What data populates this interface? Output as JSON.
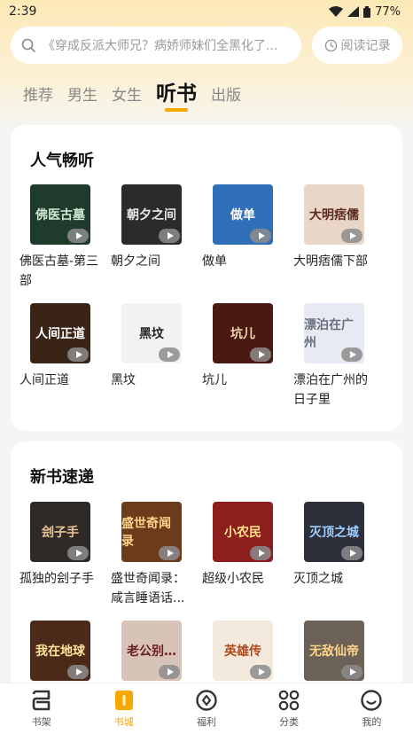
{
  "status": {
    "time": "2:39",
    "battery": "77%"
  },
  "search": {
    "placeholder": "《穿成反派大师兄？病娇师妹们全黑化了...",
    "history_label": "阅读记录"
  },
  "tabs": [
    {
      "label": "推荐",
      "active": false
    },
    {
      "label": "男生",
      "active": false
    },
    {
      "label": "女生",
      "active": false
    },
    {
      "label": "听书",
      "active": true
    },
    {
      "label": "出版",
      "active": false
    }
  ],
  "sections": [
    {
      "title": "人气畅听",
      "books": [
        {
          "title": "佛医古墓-第三部",
          "cover_text": "佛医古墓",
          "cover_bg": "#1f3b2c",
          "cover_fg": "#cfe8d4"
        },
        {
          "title": "朝夕之间",
          "cover_text": "朝夕之间",
          "cover_bg": "#2b2b2b",
          "cover_fg": "#e8e8e8"
        },
        {
          "title": "做单",
          "cover_text": "做单",
          "cover_bg": "#2e6fb7",
          "cover_fg": "#ffffff"
        },
        {
          "title": "大明痞儒下部",
          "cover_text": "大明痞儒",
          "cover_bg": "#e9d6c7",
          "cover_fg": "#5a2b1e"
        },
        {
          "title": "人间正道",
          "cover_text": "人间正道",
          "cover_bg": "#3a2416",
          "cover_fg": "#ffffff"
        },
        {
          "title": "黑坟",
          "cover_text": "黑坟",
          "cover_bg": "#f2f2f2",
          "cover_fg": "#222222"
        },
        {
          "title": "坑儿",
          "cover_text": "坑儿",
          "cover_bg": "#4a1a12",
          "cover_fg": "#f1d7b0"
        },
        {
          "title": "漂泊在广州的日子里",
          "cover_text": "漂泊在广州",
          "cover_bg": "#e7eaf2",
          "cover_fg": "#6a6f80"
        }
      ]
    },
    {
      "title": "新书速递",
      "books": [
        {
          "title": "孤独的刽子手",
          "cover_text": "刽子手",
          "cover_bg": "#2f2a25",
          "cover_fg": "#e7c39a"
        },
        {
          "title": "盛世奇闻录：咸言睡语话...",
          "cover_text": "盛世奇闻录",
          "cover_bg": "#6b3b1c",
          "cover_fg": "#ffd48a"
        },
        {
          "title": "超级小农民",
          "cover_text": "小农民",
          "cover_bg": "#8d1e1e",
          "cover_fg": "#ffe08a"
        },
        {
          "title": "灭顶之城",
          "cover_text": "灭顶之城",
          "cover_bg": "#2d2f3a",
          "cover_fg": "#9ed0ff"
        },
        {
          "title": "",
          "cover_text": "我在地球",
          "cover_bg": "#4b2a1a",
          "cover_fg": "#ffe49a"
        },
        {
          "title": "",
          "cover_text": "老公别…",
          "cover_bg": "#d8c3b8",
          "cover_fg": "#6b1f1f"
        },
        {
          "title": "",
          "cover_text": "英雄传",
          "cover_bg": "#f3e9dc",
          "cover_fg": "#b14a1b"
        },
        {
          "title": "",
          "cover_text": "无敌仙帝",
          "cover_bg": "#6c6156",
          "cover_fg": "#ffd48a"
        }
      ]
    }
  ],
  "nav": [
    {
      "label": "书架",
      "icon": "bookshelf-icon",
      "active": false
    },
    {
      "label": "书城",
      "icon": "bookstore-icon",
      "active": true
    },
    {
      "label": "福利",
      "icon": "welfare-icon",
      "active": false
    },
    {
      "label": "分类",
      "icon": "category-icon",
      "active": false
    },
    {
      "label": "我的",
      "icon": "profile-icon",
      "active": false
    }
  ],
  "colors": {
    "accent": "#f7a800",
    "header_bg": "#fde9b6"
  }
}
